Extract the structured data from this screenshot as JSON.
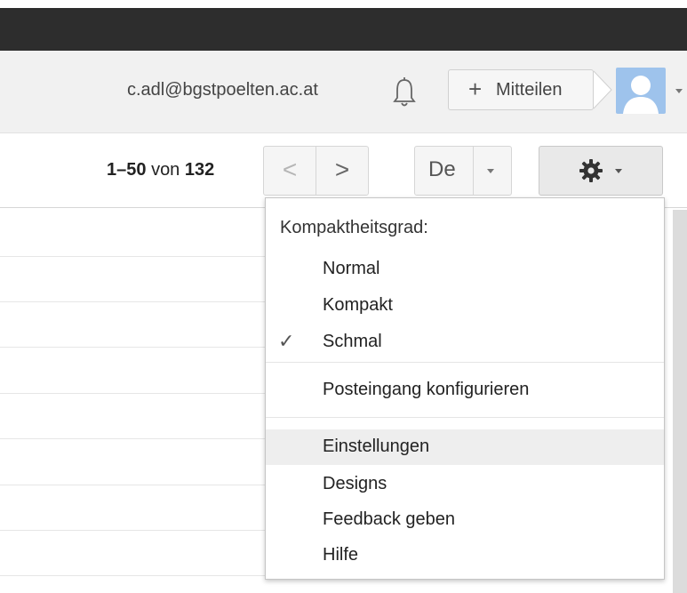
{
  "account": {
    "email": "c.adl@bgstpoelten.ac.at",
    "share_label": "Mitteilen"
  },
  "toolbar": {
    "page_range": "1–50",
    "page_von": "von",
    "page_total": "132",
    "prev_glyph": "<",
    "next_glyph": ">",
    "language_label": "De"
  },
  "settings_menu": {
    "header": "Kompaktheitsgrad:",
    "density_options": [
      {
        "label": "Normal",
        "checked": false
      },
      {
        "label": "Kompakt",
        "checked": false
      },
      {
        "label": "Schmal",
        "checked": true
      }
    ],
    "check_glyph": "✓",
    "configure_label": "Posteingang konfigurieren",
    "items": [
      "Einstellungen",
      "Designs",
      "Feedback geben",
      "Hilfe"
    ],
    "highlighted_item": "Einstellungen"
  },
  "icons": [
    "bell-icon",
    "plus-icon",
    "avatar-icon",
    "chevron-down-icon",
    "gear-icon",
    "check-icon"
  ],
  "colors": {
    "topbar": "#2d2d2d",
    "account_bar": "#f1f1f1",
    "avatar_bg": "#9ec3ec",
    "menu_hover": "#eeeeee"
  }
}
